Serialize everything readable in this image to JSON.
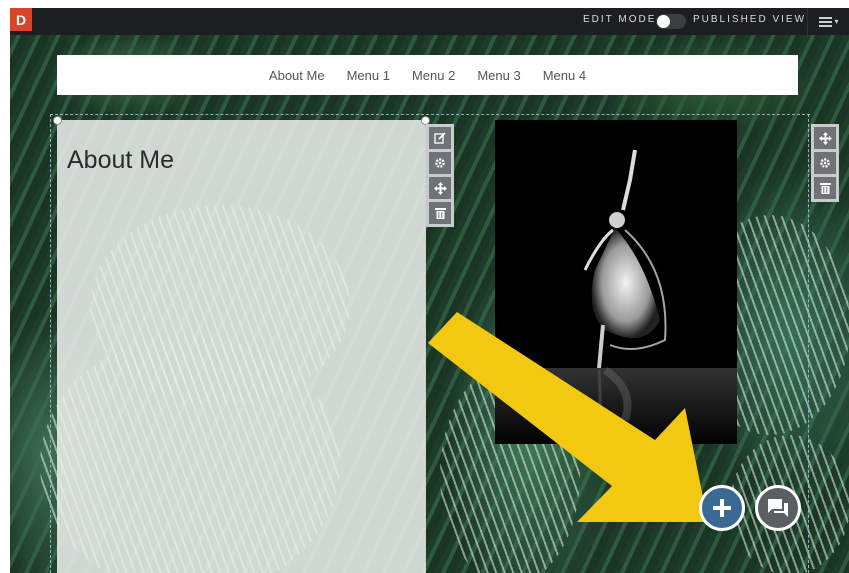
{
  "topbar": {
    "logo_letter": "D",
    "edit_mode_label": "EDIT MODE",
    "published_view_label": "PUBLISHED VIEW",
    "menu_icon": "hamburger-icon",
    "menu_caret": "▾"
  },
  "nav": {
    "items": [
      {
        "label": "About Me"
      },
      {
        "label": "Menu 1"
      },
      {
        "label": "Menu 2"
      },
      {
        "label": "Menu 3"
      },
      {
        "label": "Menu 4"
      }
    ]
  },
  "content": {
    "about_title": "About Me"
  },
  "toolbar_left": {
    "icons": [
      "edit-icon",
      "gear-icon",
      "move-icon",
      "trash-icon"
    ]
  },
  "toolbar_right": {
    "icons": [
      "move-icon",
      "gear-icon",
      "trash-icon"
    ]
  },
  "fabs": {
    "add_icon": "plus-icon",
    "chat_icon": "chat-icon"
  },
  "colors": {
    "topbar_bg": "#1c1f22",
    "logo_bg": "#d9442a",
    "arrow": "#f2c811",
    "fab_add": "#3a6a93",
    "fab_chat": "#5a5f63"
  }
}
